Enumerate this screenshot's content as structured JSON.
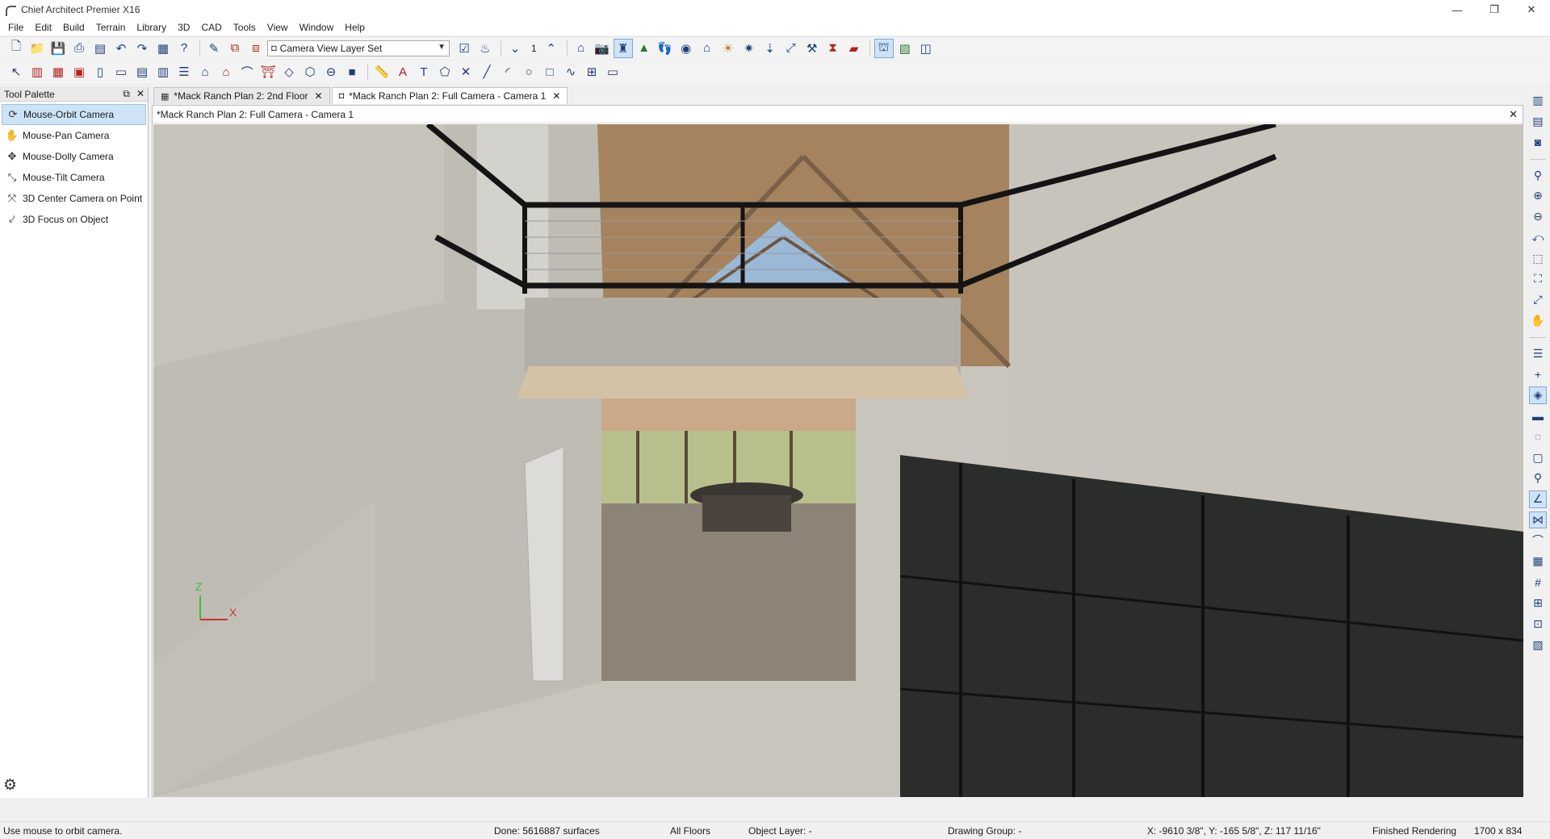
{
  "window": {
    "title": "Chief Architect Premier X16",
    "controls": [
      "—",
      "❐",
      "✕"
    ]
  },
  "menu": [
    "File",
    "Edit",
    "Build",
    "Terrain",
    "Library",
    "3D",
    "CAD",
    "Tools",
    "View",
    "Window",
    "Help"
  ],
  "toolbar": {
    "layer_set": "Camera View Layer Set",
    "floor_number": "1"
  },
  "palette": {
    "title": "Tool Palette",
    "items": [
      {
        "label": "Mouse-Orbit Camera",
        "icon": "orbit-icon",
        "selected": true
      },
      {
        "label": "Mouse-Pan Camera",
        "icon": "pan-icon",
        "selected": false
      },
      {
        "label": "Mouse-Dolly Camera",
        "icon": "dolly-icon",
        "selected": false
      },
      {
        "label": "Mouse-Tilt Camera",
        "icon": "tilt-icon",
        "selected": false
      },
      {
        "label": "3D Center Camera on Point",
        "icon": "center-icon",
        "selected": false
      },
      {
        "label": "3D Focus on Object",
        "icon": "focus-icon",
        "selected": false
      }
    ]
  },
  "tabs": [
    {
      "label": "*Mack Ranch Plan 2: 2nd Floor",
      "active": false
    },
    {
      "label": "*Mack Ranch Plan 2: Full Camera - Camera 1",
      "active": true
    }
  ],
  "view": {
    "title": "*Mack Ranch Plan 2: Full Camera - Camera 1",
    "axis": {
      "z": "Z",
      "x": "X"
    }
  },
  "status": {
    "hint": "Use mouse to orbit camera.",
    "surfaces": "Done:  5616887 surfaces",
    "floors": "All Floors",
    "object_layer": "Object Layer: -",
    "drawing_group": "Drawing Group: -",
    "coords": "X: -9610 3/8\", Y: -165 5/8\", Z: 117 11/16\"",
    "render_state": "Finished Rendering",
    "resolution": "1700 x 834"
  },
  "colors": {
    "accent": "#1f3f7a",
    "selection": "#cde4f7",
    "wall": "#c9c6be",
    "floor": "#8c8376",
    "ceiling_wood": "#a5835e"
  }
}
